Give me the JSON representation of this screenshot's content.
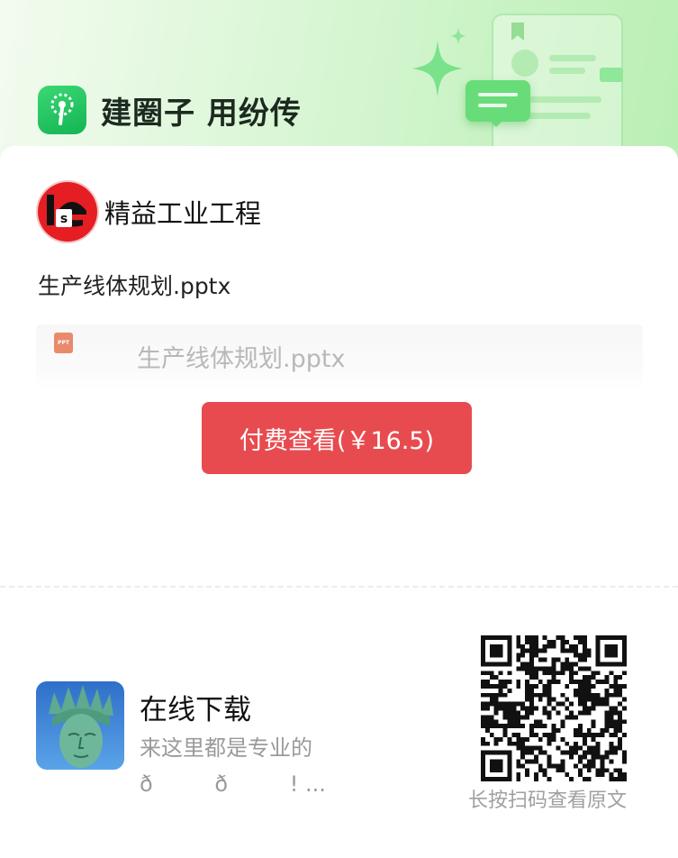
{
  "brand": {
    "app_name": "建圈子 用纷传",
    "accent": "#22c55e"
  },
  "author": {
    "name": "精益工业工程",
    "logo_text": "Ie",
    "logo_color": "#e51e24"
  },
  "file": {
    "title": "生产线体规划.pptx",
    "preview_name": "生产线体规划.pptx",
    "icon": "ppt-file-icon",
    "icon_text": "PPT"
  },
  "pay_button": {
    "label": "付费查看(￥16.5)",
    "color": "#e84b4f"
  },
  "download": {
    "title": "在线下载",
    "description": "来这里都是专业的ð         ð         ! ..."
  },
  "qr": {
    "caption": "长按扫码查看原文"
  }
}
